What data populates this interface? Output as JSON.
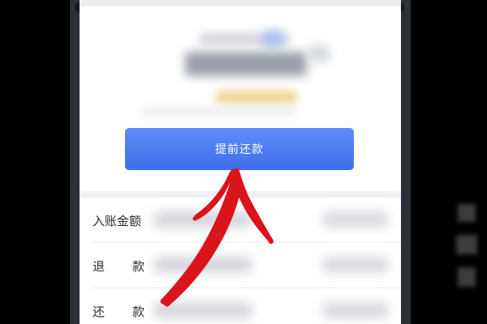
{
  "colors": {
    "accent_button": "#4a7cf0",
    "annotation_arrow": "#d9141b",
    "frame": "#2b3038",
    "background": "#000000"
  },
  "repayment": {
    "prepay_button_label": "提前还款"
  },
  "details": {
    "rows": [
      {
        "label": "入账金额"
      },
      {
        "label_chars": [
          "退",
          "款"
        ]
      },
      {
        "label_chars": [
          "还",
          "款"
        ]
      }
    ]
  },
  "annotation": {
    "icon": "red-hand-drawn-arrow-icon"
  }
}
